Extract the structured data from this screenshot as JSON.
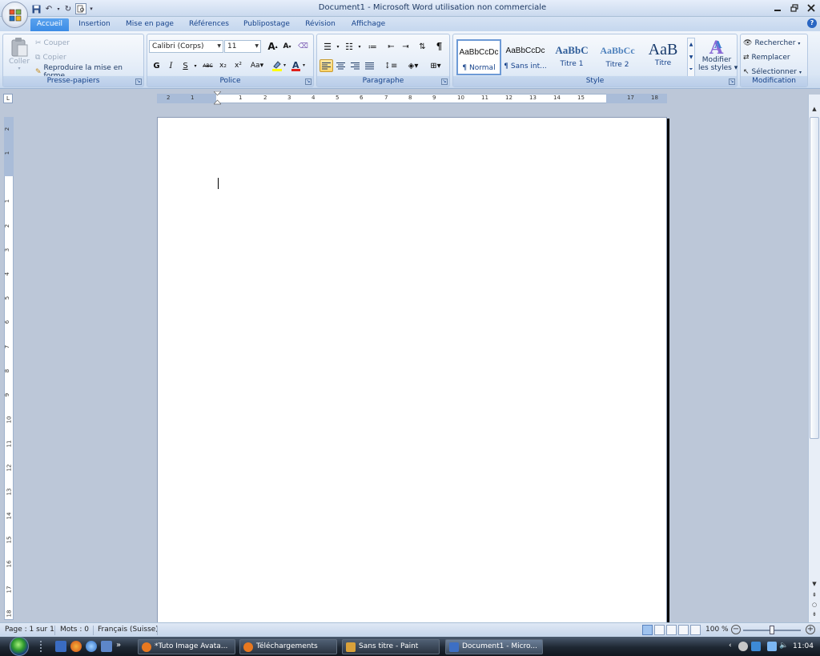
{
  "window": {
    "title": "Document1 - Microsoft Word utilisation non commerciale",
    "controls": [
      "minimize",
      "restore",
      "close"
    ]
  },
  "quick_access": [
    "save-icon",
    "undo-icon",
    "redo-icon",
    "print-preview-icon",
    "customize-icon"
  ],
  "tabs": [
    {
      "label": "Accueil",
      "active": true
    },
    {
      "label": "Insertion"
    },
    {
      "label": "Mise en page"
    },
    {
      "label": "Références"
    },
    {
      "label": "Publipostage"
    },
    {
      "label": "Révision"
    },
    {
      "label": "Affichage"
    }
  ],
  "ribbon": {
    "clipboard": {
      "label": "Presse-papiers",
      "paste": "Coller",
      "cut": "Couper",
      "copy": "Copier",
      "format_painter": "Reproduire la mise en forme"
    },
    "font": {
      "label": "Police",
      "font_name": "Calibri (Corps)",
      "font_size": "11",
      "bold": "G",
      "italic": "I",
      "underline": "S",
      "strike": "ABC",
      "subscript": "x₂",
      "superscript": "x²",
      "change_case": "Aa",
      "font_color": "A",
      "highlight_color": "#ffff00",
      "text_color": "#e0201b"
    },
    "paragraph": {
      "label": "Paragraphe",
      "pilcrow": "¶"
    },
    "styles": {
      "label": "Style",
      "items": [
        {
          "preview": "AaBbCcDc",
          "name": "¶ Normal",
          "selected": true
        },
        {
          "preview": "AaBbCcDc",
          "name": "¶ Sans int..."
        },
        {
          "preview": "AaBbC",
          "name": "Titre 1"
        },
        {
          "preview": "AaBbCc",
          "name": "Titre 2"
        },
        {
          "preview": "AaB",
          "name": "Titre"
        }
      ],
      "modify_line1": "Modifier",
      "modify_line2": "les styles"
    },
    "editing": {
      "label": "Modification",
      "find": "Rechercher",
      "replace": "Remplacer",
      "select": "Sélectionner"
    }
  },
  "ruler": {
    "h_ticks": [
      "2",
      "1",
      "1",
      "2",
      "3",
      "4",
      "5",
      "6",
      "7",
      "8",
      "9",
      "10",
      "11",
      "12",
      "13",
      "14",
      "15",
      "17",
      "18"
    ],
    "v_ticks": [
      "2",
      "1",
      "1",
      "2",
      "3",
      "4",
      "5",
      "6",
      "7",
      "8",
      "9",
      "10",
      "11",
      "12",
      "13",
      "14",
      "15",
      "16",
      "17",
      "18"
    ]
  },
  "status": {
    "page": "Page : 1 sur 1",
    "words": "Mots : 0",
    "language": "Français (Suisse)",
    "zoom": "100 %"
  },
  "taskbar": {
    "items": [
      {
        "label": "*Tuto Image Avata...",
        "color": "#e8781f"
      },
      {
        "label": "Téléchargements",
        "color": "#e8781f"
      },
      {
        "label": "Sans titre - Paint",
        "color": "#d9a13a"
      },
      {
        "label": "Document1 - Micro...",
        "color": "#3d6fc4",
        "active": true
      }
    ],
    "time": "11:04"
  }
}
